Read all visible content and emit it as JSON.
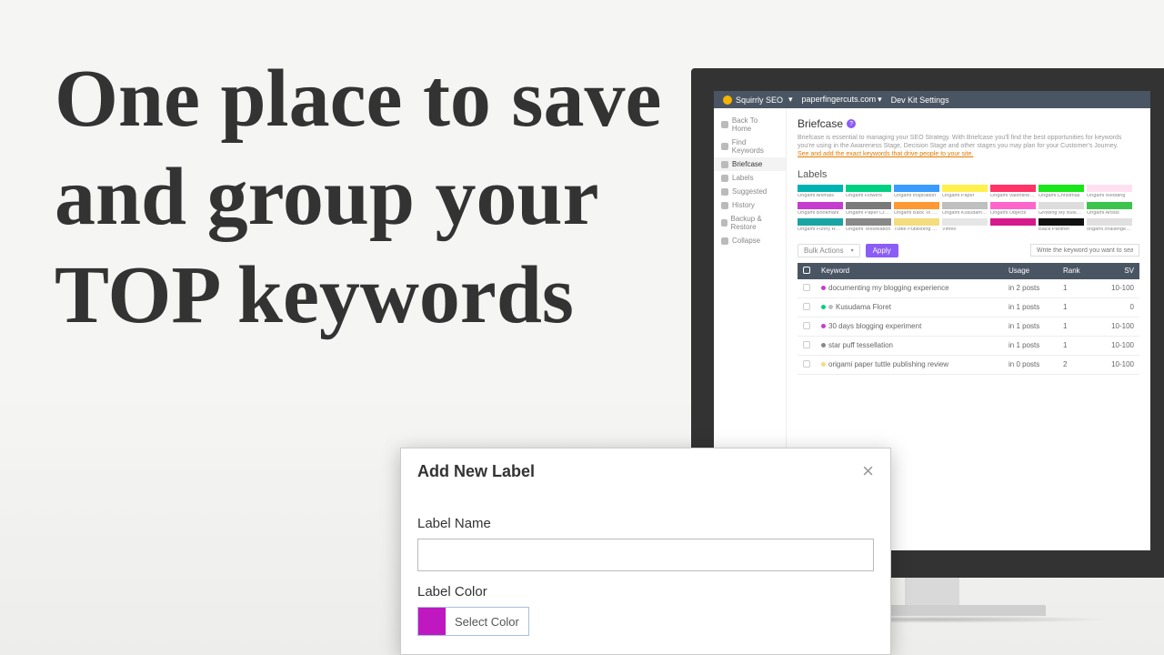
{
  "hero": "One place to save and group your TOP keywords",
  "topbar": {
    "brand": "Squirrly SEO",
    "site": "paperfingercuts.com",
    "dev": "Dev Kit Settings"
  },
  "sidebar": {
    "items": [
      {
        "label": "Back To Home"
      },
      {
        "label": "Find Keywords"
      },
      {
        "label": "Briefcase",
        "active": true
      },
      {
        "label": "Labels"
      },
      {
        "label": "Suggested"
      },
      {
        "label": "History"
      },
      {
        "label": "Backup & Restore"
      },
      {
        "label": "Collapse"
      }
    ]
  },
  "briefcase": {
    "title": "Briefcase",
    "desc1": "Briefcase is essential to managing your SEO Strategy. With Briefcase you'll find the best opportunities for keywords you're using in the Awareness Stage, Decision Stage and other stages you may plan for your Customer's Journey.",
    "desc2": "See and add the exact keywords that drive people to your site.",
    "labels_heading": "Labels",
    "labels": [
      {
        "name": "Origami Animals",
        "color": "#00b3b3"
      },
      {
        "name": "Origami Flowers",
        "color": "#00d084"
      },
      {
        "name": "Origami Inspiration",
        "color": "#3a9cff"
      },
      {
        "name": "Origami Paper",
        "color": "#fff04d"
      },
      {
        "name": "Origami Valentines Day",
        "color": "#ff3366"
      },
      {
        "name": "Origami Christmas",
        "color": "#19e619"
      },
      {
        "name": "Origami Wedding",
        "color": "#ffe0f0"
      },
      {
        "name": "Origami Bookmark",
        "color": "#c63ccf"
      },
      {
        "name": "Origami Paper Cranes",
        "color": "#7a7a7a"
      },
      {
        "name": "Origami Back To School",
        "color": "#ff9933"
      },
      {
        "name": "Origami Kusudama and Modular",
        "color": "#bfbfbf"
      },
      {
        "name": "Origami Objects",
        "color": "#ff66cc"
      },
      {
        "name": "Growing My Business",
        "color": "#dddddd"
      },
      {
        "name": "Origami Artists",
        "color": "#3cc44d"
      },
      {
        "name": "Origami Funny Holidays",
        "color": "#1aa3a3"
      },
      {
        "name": "Origami Tessellation",
        "color": "#888"
      },
      {
        "name": "Tuttle Publishing Packs",
        "color": "#f4dc7f"
      },
      {
        "name": "Vimeo",
        "color": "#e6e6e6"
      },
      {
        "name": "",
        "color": "#d61a8c"
      },
      {
        "name": "Black Panther",
        "color": "#111"
      },
      {
        "name": "origami challenge 2023",
        "color": "#e0e0e0"
      }
    ],
    "bulk": "Bulk Actions",
    "apply": "Apply",
    "search_ph": "Write the keyword you want to sear",
    "cols": {
      "keyword": "Keyword",
      "usage": "Usage",
      "rank": "Rank",
      "sv": "SV"
    },
    "rows": [
      {
        "dots": [
          "#c63ccf"
        ],
        "keyword": "documenting my blogging experience",
        "usage": "in 2 posts",
        "rank": "1",
        "sv": "10-100"
      },
      {
        "dots": [
          "#00d084",
          "#bfbfbf"
        ],
        "keyword": "Kusudama Floret",
        "usage": "in 1 posts",
        "rank": "1",
        "sv": "0"
      },
      {
        "dots": [
          "#c63ccf"
        ],
        "keyword": "30 days blogging experiment",
        "usage": "in 1 posts",
        "rank": "1",
        "sv": "10-100"
      },
      {
        "dots": [
          "#888"
        ],
        "keyword": "star puff tessellation",
        "usage": "in 1 posts",
        "rank": "1",
        "sv": "10-100"
      },
      {
        "dots": [
          "#f4dc7f"
        ],
        "keyword": "origami paper tuttle publishing review",
        "usage": "in 0 posts",
        "rank": "2",
        "sv": "10-100"
      }
    ]
  },
  "modal": {
    "title": "Add New Label",
    "name_label": "Label Name",
    "color_label": "Label Color",
    "select_color": "Select Color",
    "swatch": "#c018c0"
  }
}
